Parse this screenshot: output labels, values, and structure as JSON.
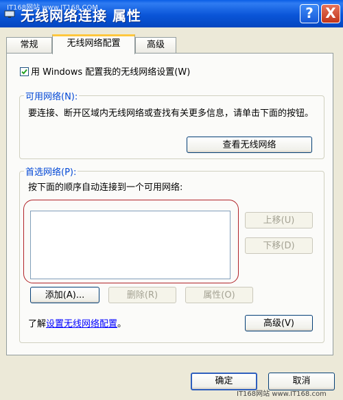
{
  "window": {
    "title": "无线网络连接 属性",
    "watermark_top": "IT168网站 www.IT168.COM",
    "help_label": "?",
    "close_label": "X"
  },
  "tabs": [
    {
      "label": "常规",
      "selected": false
    },
    {
      "label": "无线网络配置",
      "selected": true
    },
    {
      "label": "高级",
      "selected": false
    }
  ],
  "use_windows_checkbox": {
    "label": "用 Windows 配置我的无线网络设置(W)",
    "checked": true
  },
  "available_networks": {
    "legend": "可用网络(N):",
    "description": "要连接、断开区域内无线网络或查找有关更多信息，请单击下面的按钮。",
    "view_button": "查看无线网络"
  },
  "preferred_networks": {
    "legend": "首选网络(P):",
    "description": "按下面的顺序自动连接到一个可用网络:",
    "items": [],
    "move_up": "上移(U)",
    "move_down": "下移(D)",
    "add": "添加(A)...",
    "remove": "删除(R)",
    "properties": "属性(O)"
  },
  "learn_prefix": "了解",
  "learn_link": "设置无线网络配置",
  "learn_suffix": "。",
  "advanced_button": "高级(V)",
  "ok_button": "确定",
  "cancel_button": "取消",
  "watermark_bottom": "IT168网站 www.IT168.com",
  "colors": {
    "title_bar": "#0a55d8",
    "legend": "#0046d5",
    "highlight": "#b02025",
    "link": "#0000ff"
  }
}
